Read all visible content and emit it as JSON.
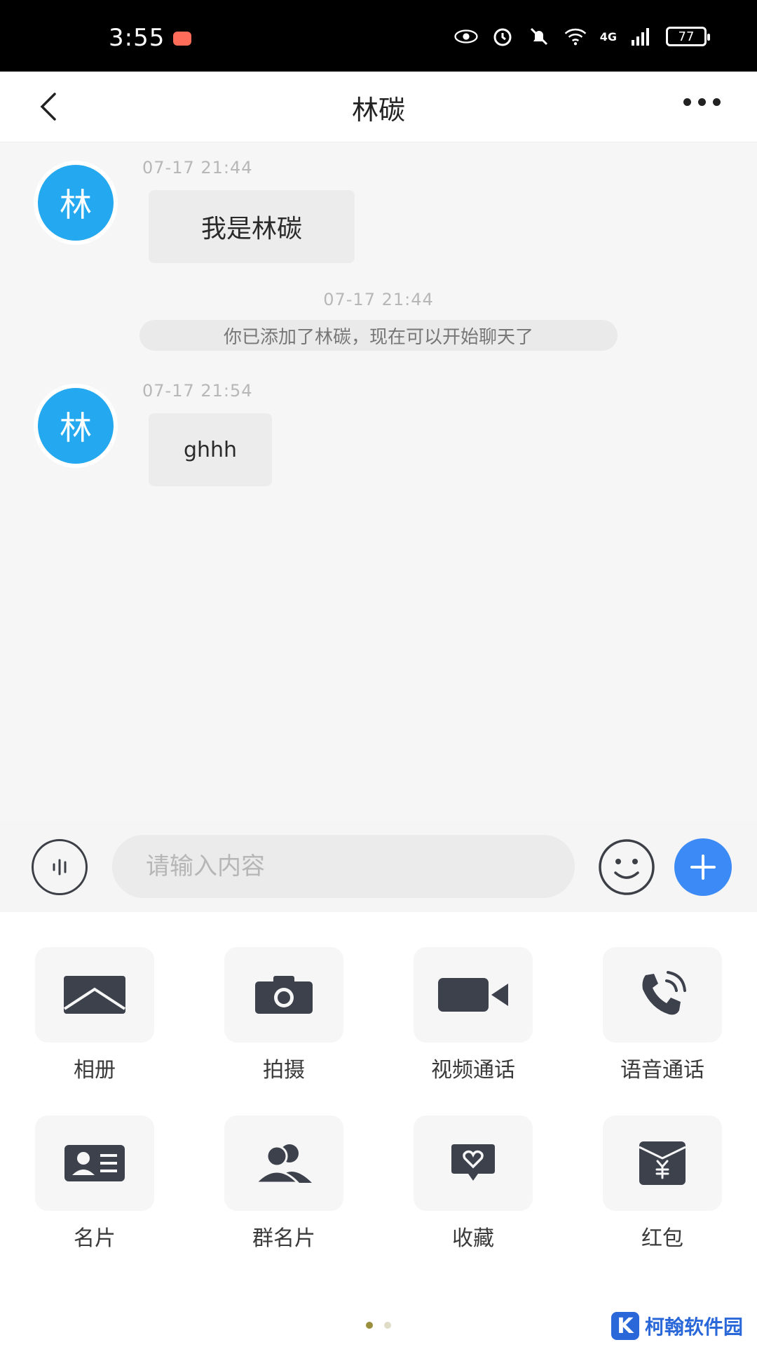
{
  "status_bar": {
    "time": "3:55",
    "network_label": "4G",
    "battery": "77"
  },
  "header": {
    "title": "林碳"
  },
  "messages": [
    {
      "time": "07-17 21:44",
      "avatar_text": "林",
      "text": "我是林碳"
    },
    {
      "system_time": "07-17 21:44",
      "system_text": "你已添加了林碳，现在可以开始聊天了"
    },
    {
      "time": "07-17 21:54",
      "avatar_text": "林",
      "text": "ghhh"
    }
  ],
  "composer": {
    "placeholder": "请输入内容"
  },
  "tools": [
    {
      "label": "相册",
      "icon": "album-icon"
    },
    {
      "label": "拍摄",
      "icon": "camera-icon"
    },
    {
      "label": "视频通话",
      "icon": "video-call-icon"
    },
    {
      "label": "语音通话",
      "icon": "voice-call-icon"
    },
    {
      "label": "名片",
      "icon": "contact-card-icon"
    },
    {
      "label": "群名片",
      "icon": "group-card-icon"
    },
    {
      "label": "收藏",
      "icon": "favorites-icon"
    },
    {
      "label": "红包",
      "icon": "red-packet-icon"
    }
  ],
  "colors": {
    "accent": "#3c8af5",
    "avatar": "#24a8f0",
    "icon": "#3c414c"
  },
  "watermark": {
    "text": "柯翰软件园"
  }
}
